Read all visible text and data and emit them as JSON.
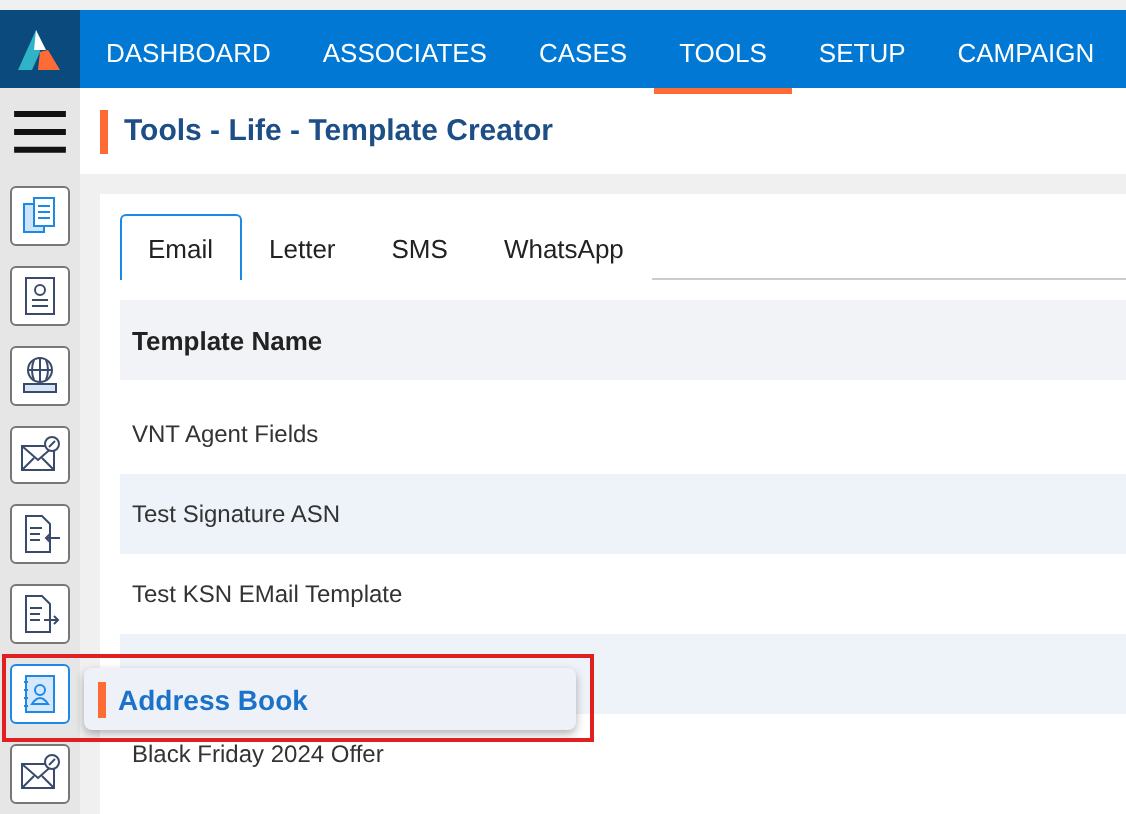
{
  "nav": {
    "items": [
      {
        "label": "DASHBOARD",
        "selected": false
      },
      {
        "label": "ASSOCIATES",
        "selected": false
      },
      {
        "label": "CASES",
        "selected": false
      },
      {
        "label": "TOOLS",
        "selected": true
      },
      {
        "label": "SETUP",
        "selected": false
      },
      {
        "label": "CAMPAIGN",
        "selected": false
      }
    ]
  },
  "page_title": "Tools - Life - Template Creator",
  "sidebar": {
    "items": [
      {
        "kind": "documents",
        "selected": false
      },
      {
        "kind": "notebook",
        "selected": false
      },
      {
        "kind": "globe",
        "selected": false
      },
      {
        "kind": "mail",
        "selected": false
      },
      {
        "kind": "import",
        "selected": false
      },
      {
        "kind": "export",
        "selected": false
      },
      {
        "kind": "contacts",
        "selected": true
      },
      {
        "kind": "mail",
        "selected": false
      }
    ]
  },
  "tooltip": {
    "label": "Address Book"
  },
  "tabs": [
    {
      "label": "Email",
      "selected": true
    },
    {
      "label": "Letter",
      "selected": false
    },
    {
      "label": "SMS",
      "selected": false
    },
    {
      "label": "WhatsApp",
      "selected": false
    }
  ],
  "table": {
    "columns": [
      "Template Name"
    ],
    "rows": [
      {
        "name": "VNT Agent Fields"
      },
      {
        "name": "Test Signature ASN"
      },
      {
        "name": "Test KSN EMail Template"
      },
      {},
      {
        "name": "Black Friday 2024 Offer"
      }
    ]
  }
}
